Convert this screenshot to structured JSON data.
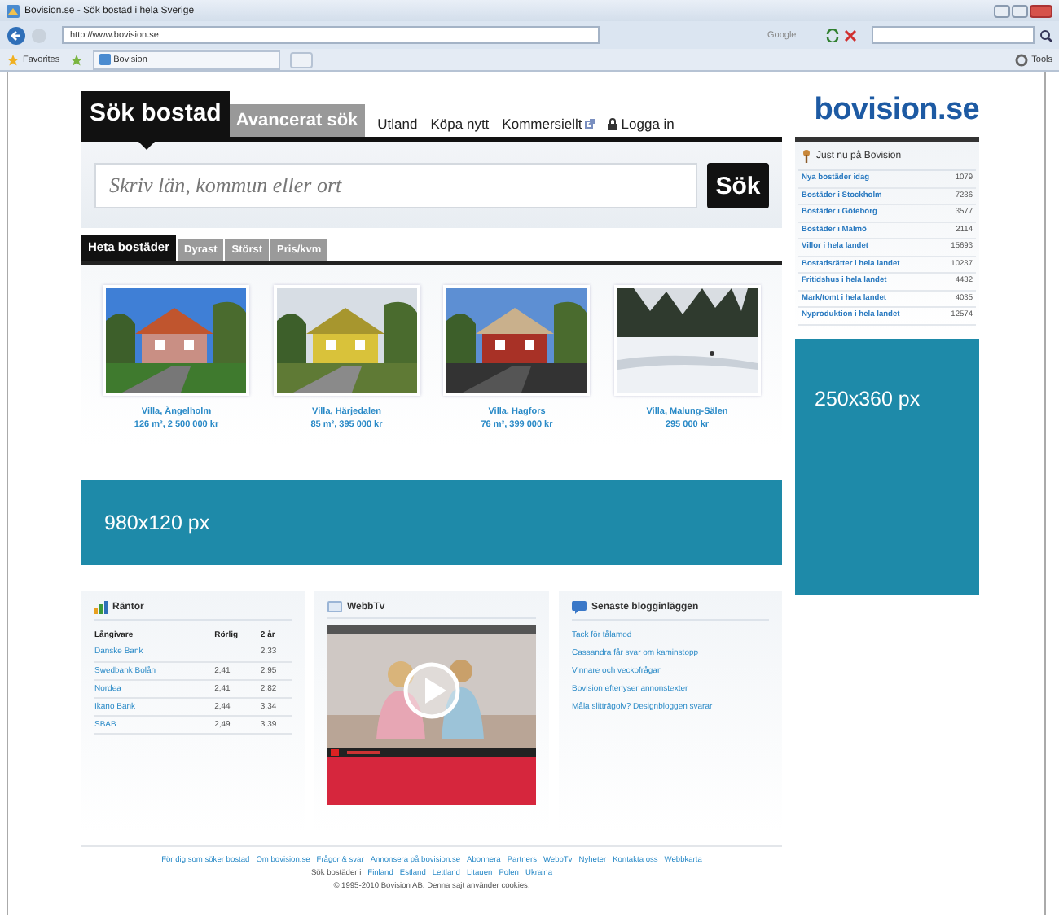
{
  "browser": {
    "title": "Bovision.se - Sök bostad i hela Sverige",
    "address": "http://www.bovision.se",
    "search_engine": "Google",
    "favorites": "Favorites",
    "tab": "Bovision",
    "tools": "Tools"
  },
  "nav": {
    "tabs": [
      {
        "label": "Sök bostad",
        "selected": true
      },
      {
        "label": "Avancerat sök",
        "selected": false
      }
    ],
    "links": [
      {
        "label": "Utland",
        "kind": "plain"
      },
      {
        "label": "Köpa nytt",
        "kind": "plain"
      },
      {
        "label": "Kommersiellt",
        "kind": "external"
      },
      {
        "label": "Logga in",
        "kind": "login"
      }
    ]
  },
  "logo": "bovision.se",
  "search": {
    "placeholder": "Skriv län, kommun eller ort",
    "button": "Sök"
  },
  "listing_tabs": [
    {
      "label": "Heta bostäder",
      "selected": true
    },
    {
      "label": "Dyrast",
      "selected": false
    },
    {
      "label": "Störst",
      "selected": false
    },
    {
      "label": "Pris/kvm",
      "selected": false
    }
  ],
  "listings": [
    {
      "title": "Villa, Ängelholm",
      "details": "126 m², 2 500 000 kr"
    },
    {
      "title": "Villa, Härjedalen",
      "details": "85 m², 395 000 kr"
    },
    {
      "title": "Villa, Hagfors",
      "details": "76 m², 399 000 kr"
    },
    {
      "title": "Villa, Malung-Sälen",
      "details": "295 000 kr"
    }
  ],
  "banner_ad": "980x120 px",
  "sidebar": {
    "title": "Just nu på Bovision",
    "items": [
      {
        "label": "Nya bostäder idag",
        "count": "1079"
      },
      {
        "label": "Bostäder i Stockholm",
        "count": "7236"
      },
      {
        "label": "Bostäder i Göteborg",
        "count": "3577"
      },
      {
        "label": "Bostäder i Malmö",
        "count": "2114"
      },
      {
        "label": "Villor i hela landet",
        "count": "15693"
      },
      {
        "label": "Bostadsrätter i hela landet",
        "count": "10237"
      },
      {
        "label": "Fritidshus i hela landet",
        "count": "4432"
      },
      {
        "label": "Mark/tomt i hela landet",
        "count": "4035"
      },
      {
        "label": "Nyproduktion i hela landet",
        "count": "12574"
      }
    ]
  },
  "side_ad": "250x360 px",
  "rates": {
    "title": "Räntor",
    "columns": [
      "Långivare",
      "Rörlig",
      "2 år"
    ],
    "rows": [
      [
        "Danske Bank",
        "",
        "2,33"
      ],
      [
        "Swedbank Bolån",
        "2,41",
        "2,95"
      ],
      [
        "Nordea",
        "2,41",
        "2,82"
      ],
      [
        "Ikano Bank",
        "2,44",
        "3,34"
      ],
      [
        "SBAB",
        "2,49",
        "3,39"
      ]
    ]
  },
  "webtv": {
    "title": "WebbTv"
  },
  "blog": {
    "title": "Senaste blogginläggen",
    "posts": [
      "Tack för tålamod",
      "Cassandra får svar om kaminstopp",
      "Vinnare och veckofrågan",
      "Bovision efterlyser annonstexter",
      "Måla slitträgolv? Designbloggen svarar"
    ]
  },
  "footer": {
    "links": [
      "För dig som söker bostad",
      "Om bovision.se",
      "Frågor & svar",
      "Annonsera på bovision.se",
      "Abonnera",
      "Partners",
      "WebbTv",
      "Nyheter",
      "Kontakta oss",
      "Webbkarta"
    ],
    "countries_label": "Sök bostäder i",
    "countries": [
      "Finland",
      "Estland",
      "Lettland",
      "Litauen",
      "Polen",
      "Ukraina"
    ],
    "copyright": "© 1995-2010 Bovision AB. Denna sajt använder cookies."
  }
}
